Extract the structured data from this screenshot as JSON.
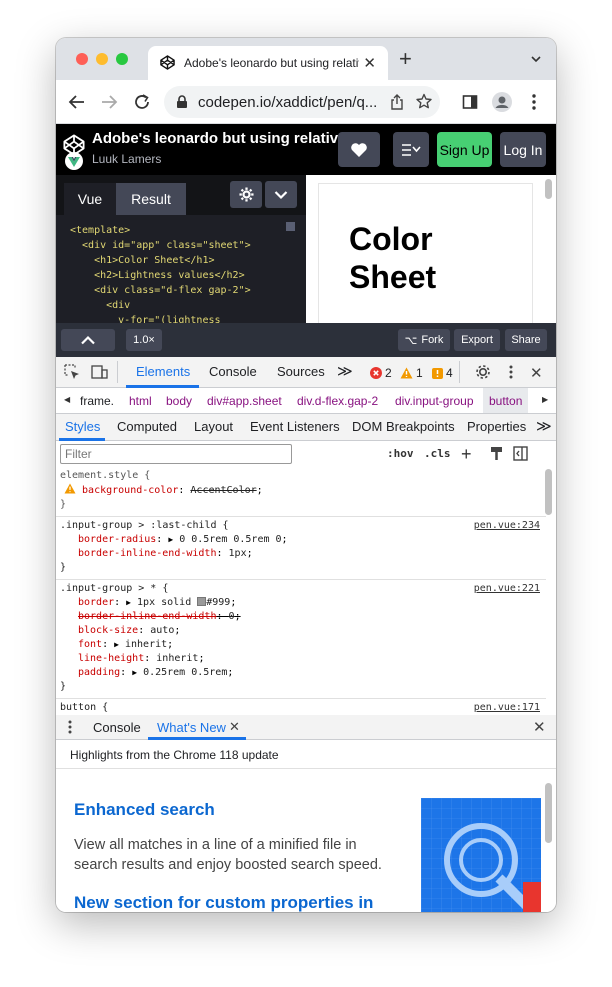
{
  "browser": {
    "tab_title": "Adobe's leonardo but using relative",
    "url": "codepen.io/xaddict/pen/q..."
  },
  "codepen": {
    "pen_title": "Adobe's leonardo but using relative ...",
    "author": "Luuk Lamers",
    "signup_label": "Sign Up",
    "login_label": "Log In",
    "editor_tabs": [
      "Vue",
      "Result"
    ],
    "code_lines": [
      "<template>",
      "  <div id=\"app\" class=\"sheet\">",
      "    <h1>Color Sheet</h1>",
      "    <h2>Lightness values</h2>",
      "    <div class=\"d-flex gap-2\">",
      "      <div",
      "        v-for=\"(lightness"
    ],
    "preview_heading": "Color Sheet",
    "zoom": "1.0×",
    "fork_label": "Fork",
    "export_label": "Export",
    "share_label": "Share"
  },
  "devtools": {
    "tabs": [
      "Elements",
      "Console",
      "Sources"
    ],
    "errors": "2",
    "warnings": "1",
    "issues": "4",
    "breadcrumbs": [
      "frame.",
      "html",
      "body",
      "div#app.sheet",
      "div.d-flex.gap-2",
      "div.input-group",
      "button"
    ],
    "subtabs": [
      "Styles",
      "Computed",
      "Layout",
      "Event Listeners",
      "DOM Breakpoints",
      "Properties"
    ],
    "filter_placeholder": "Filter",
    "hov": ":hov",
    "cls": ".cls",
    "rules": [
      {
        "selector": "element.style {",
        "source": "",
        "decls": [
          {
            "name": "background-color",
            "value": "AccentColor",
            "warn": true,
            "strike_value": true
          }
        ]
      },
      {
        "selector": ".input-group > :last-child {",
        "source": "pen.vue:234",
        "decls": [
          {
            "name": "border-radius",
            "value": "0 0.5rem 0.5rem 0",
            "arrow": true
          },
          {
            "name": "border-inline-end-width",
            "value": "1px"
          }
        ]
      },
      {
        "selector": ".input-group > * {",
        "source": "pen.vue:221",
        "decls": [
          {
            "name": "border",
            "value": "1px solid #999",
            "arrow": true,
            "swatch": "#999999"
          },
          {
            "name": "border-inline-end-width",
            "value": "0",
            "strike": true
          },
          {
            "name": "block-size",
            "value": "auto"
          },
          {
            "name": "font",
            "value": "inherit",
            "arrow": true
          },
          {
            "name": "line-height",
            "value": "inherit"
          },
          {
            "name": "padding",
            "value": "0.25rem 0.5rem",
            "arrow": true
          }
        ]
      },
      {
        "selector": "button {",
        "source": "pen.vue:171",
        "decls": []
      }
    ],
    "drawer_tabs": [
      "Console",
      "What's New"
    ],
    "highlights": "Highlights from the Chrome 118 update",
    "whatsnew_title1": "Enhanced search",
    "whatsnew_body1": "View all matches in a line of a minified file in search results and enjoy boosted search speed.",
    "whatsnew_title2": "New section for custom properties in"
  },
  "colors": {
    "signup_green": "#47cf73",
    "devtools_blue": "#1a73e8",
    "link_blue": "#0b67d0"
  }
}
